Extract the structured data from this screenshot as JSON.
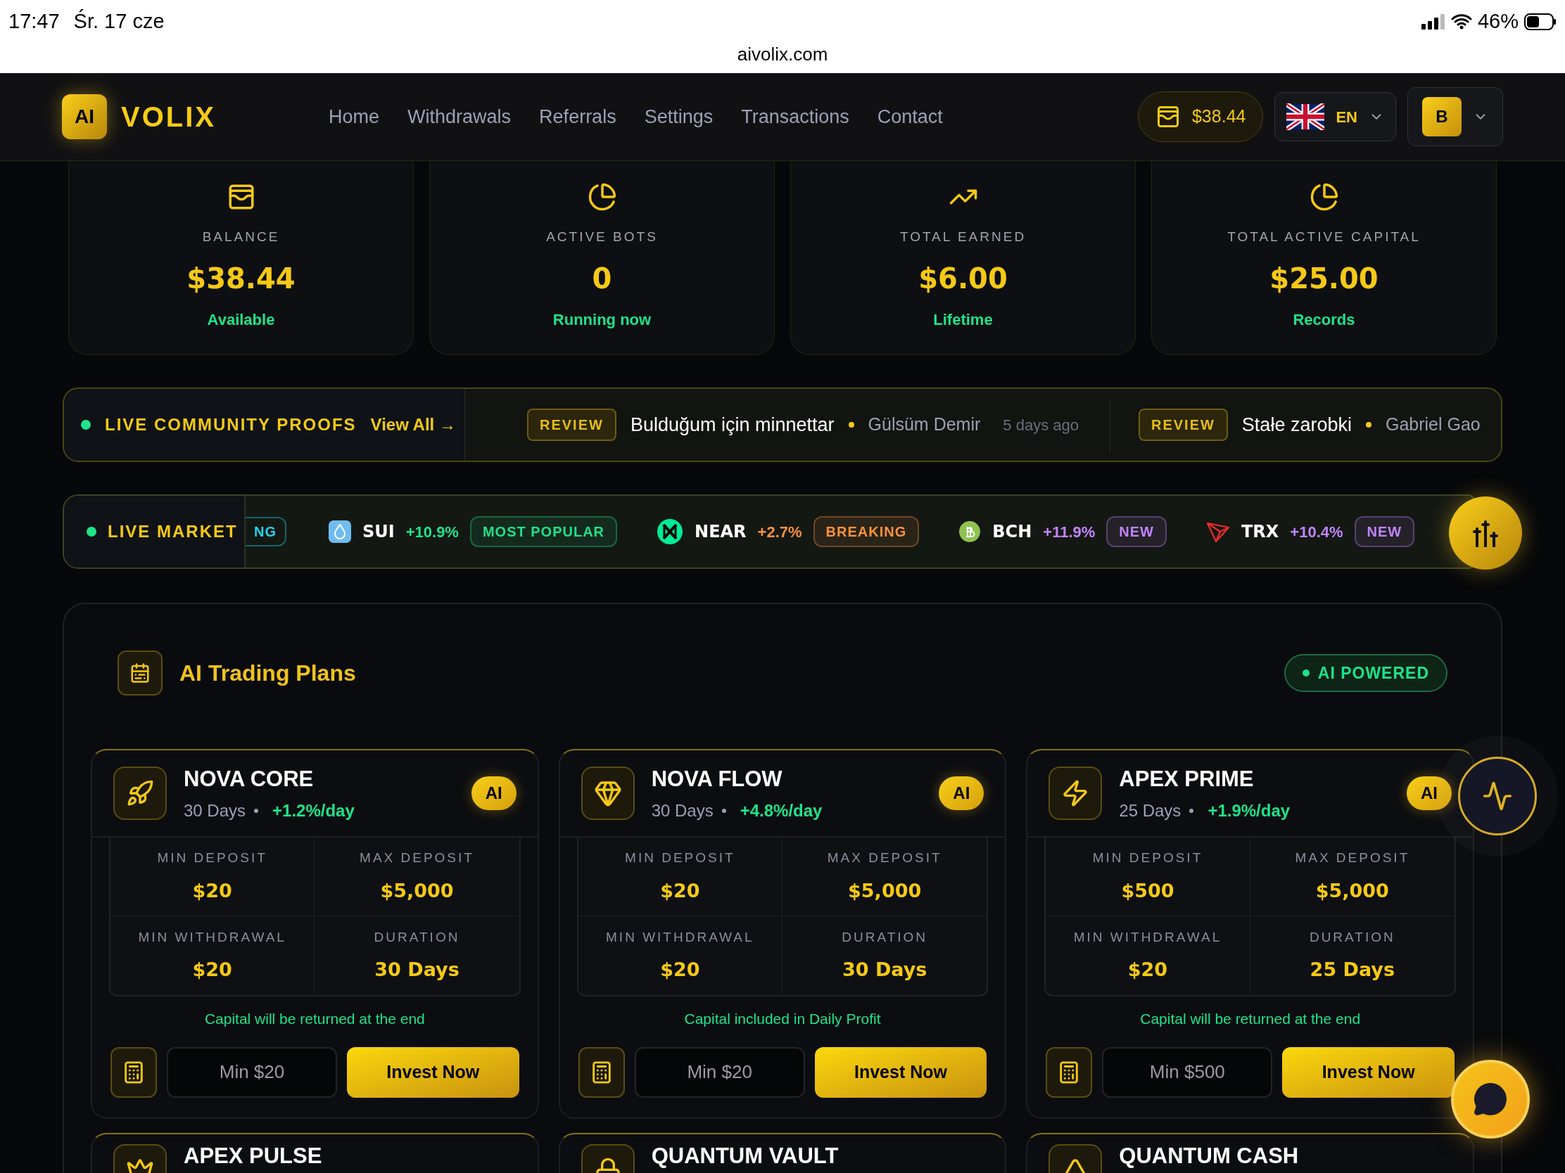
{
  "status_bar": {
    "time": "17:47",
    "date": "Śr. 17 cze",
    "battery": "46%"
  },
  "address_bar": {
    "url": "aivolix.com"
  },
  "header": {
    "logo_badge": "AI",
    "logo_text": "VOLIX",
    "nav": [
      {
        "label": "Home"
      },
      {
        "label": "Withdrawals"
      },
      {
        "label": "Referrals"
      },
      {
        "label": "Settings"
      },
      {
        "label": "Transactions"
      },
      {
        "label": "Contact"
      }
    ],
    "balance": "$38.44",
    "language": "EN",
    "avatar": "B"
  },
  "stats": [
    {
      "label": "BALANCE",
      "value": "$38.44",
      "note": "Available"
    },
    {
      "label": "ACTIVE BOTS",
      "value": "0",
      "note": "Running now"
    },
    {
      "label": "TOTAL EARNED",
      "value": "$6.00",
      "note": "Lifetime"
    },
    {
      "label": "TOTAL ACTIVE CAPITAL",
      "value": "$25.00",
      "note": "Records"
    }
  ],
  "proofs": {
    "title": "LIVE COMMUNITY PROOFS",
    "link": "View All →",
    "items": [
      {
        "tag": "REVIEW",
        "text": "Bulduğum için minnettar",
        "author": "Gülsüm Demir",
        "time": "5 days ago"
      },
      {
        "tag": "REVIEW",
        "text": "Stałe zarobki",
        "author": "Gabriel Gao"
      }
    ]
  },
  "market": {
    "title": "LIVE MARKET",
    "lead_badge": {
      "text": "NG",
      "color": "#22d3ee"
    },
    "items": [
      {
        "symbol": "SUI",
        "change": "+10.9%",
        "badge": "MOST POPULAR",
        "color": "#22e08a"
      },
      {
        "symbol": "NEAR",
        "change": "+2.7%",
        "badge": "BREAKING",
        "color": "#fb923c"
      },
      {
        "symbol": "BCH",
        "change": "+11.9%",
        "badge": "NEW",
        "color": "#c084fc"
      },
      {
        "symbol": "TRX",
        "change": "+10.4%",
        "badge": "NEW",
        "color": "#c084fc"
      }
    ]
  },
  "plans_section": {
    "title": "AI Trading Plans",
    "badge": "AI POWERED",
    "plans": [
      {
        "name": "NOVA CORE",
        "days": "30 Days",
        "rate": "+1.2%/day",
        "badge": "AI",
        "details": [
          {
            "label": "MIN DEPOSIT",
            "value": "$20"
          },
          {
            "label": "MAX DEPOSIT",
            "value": "$5,000"
          },
          {
            "label": "MIN WITHDRAWAL",
            "value": "$20"
          },
          {
            "label": "DURATION",
            "value": "30 Days"
          }
        ],
        "note": "Capital will be returned at the end",
        "amount_placeholder": "Min $20",
        "button": "Invest Now"
      },
      {
        "name": "NOVA FLOW",
        "days": "30 Days",
        "rate": "+4.8%/day",
        "badge": "AI",
        "details": [
          {
            "label": "MIN DEPOSIT",
            "value": "$20"
          },
          {
            "label": "MAX DEPOSIT",
            "value": "$5,000"
          },
          {
            "label": "MIN WITHDRAWAL",
            "value": "$20"
          },
          {
            "label": "DURATION",
            "value": "30 Days"
          }
        ],
        "note": "Capital included in Daily Profit",
        "amount_placeholder": "Min $20",
        "button": "Invest Now"
      },
      {
        "name": "APEX PRIME",
        "days": "25 Days",
        "rate": "+1.9%/day",
        "badge": "AI",
        "details": [
          {
            "label": "MIN DEPOSIT",
            "value": "$500"
          },
          {
            "label": "MAX DEPOSIT",
            "value": "$5,000"
          },
          {
            "label": "MIN WITHDRAWAL",
            "value": "$20"
          },
          {
            "label": "DURATION",
            "value": "25 Days"
          }
        ],
        "note": "Capital will be returned at the end",
        "amount_placeholder": "Min $500",
        "button": "Invest Now"
      }
    ],
    "more_plans": [
      {
        "name": "APEX PULSE"
      },
      {
        "name": "QUANTUM VAULT"
      },
      {
        "name": "QUANTUM CASH"
      }
    ]
  }
}
